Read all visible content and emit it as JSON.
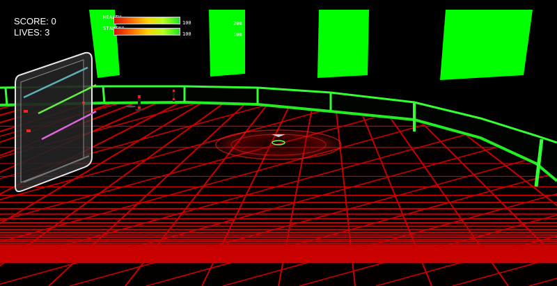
{
  "hud": {
    "score_text": "SCORE: 0",
    "lives_text": "LIVES: 3",
    "health": {
      "label": "HEALTH",
      "value": 100,
      "max_text": "100"
    },
    "stamina": {
      "label": "STAMINA",
      "value": 100,
      "max_text": "100"
    },
    "readout_top": "200",
    "readout_bottom": "100"
  },
  "colors": {
    "grid": "#c80000",
    "wall_neon": "#33ff33",
    "pillar": "#00ff00",
    "background": "#000000"
  }
}
